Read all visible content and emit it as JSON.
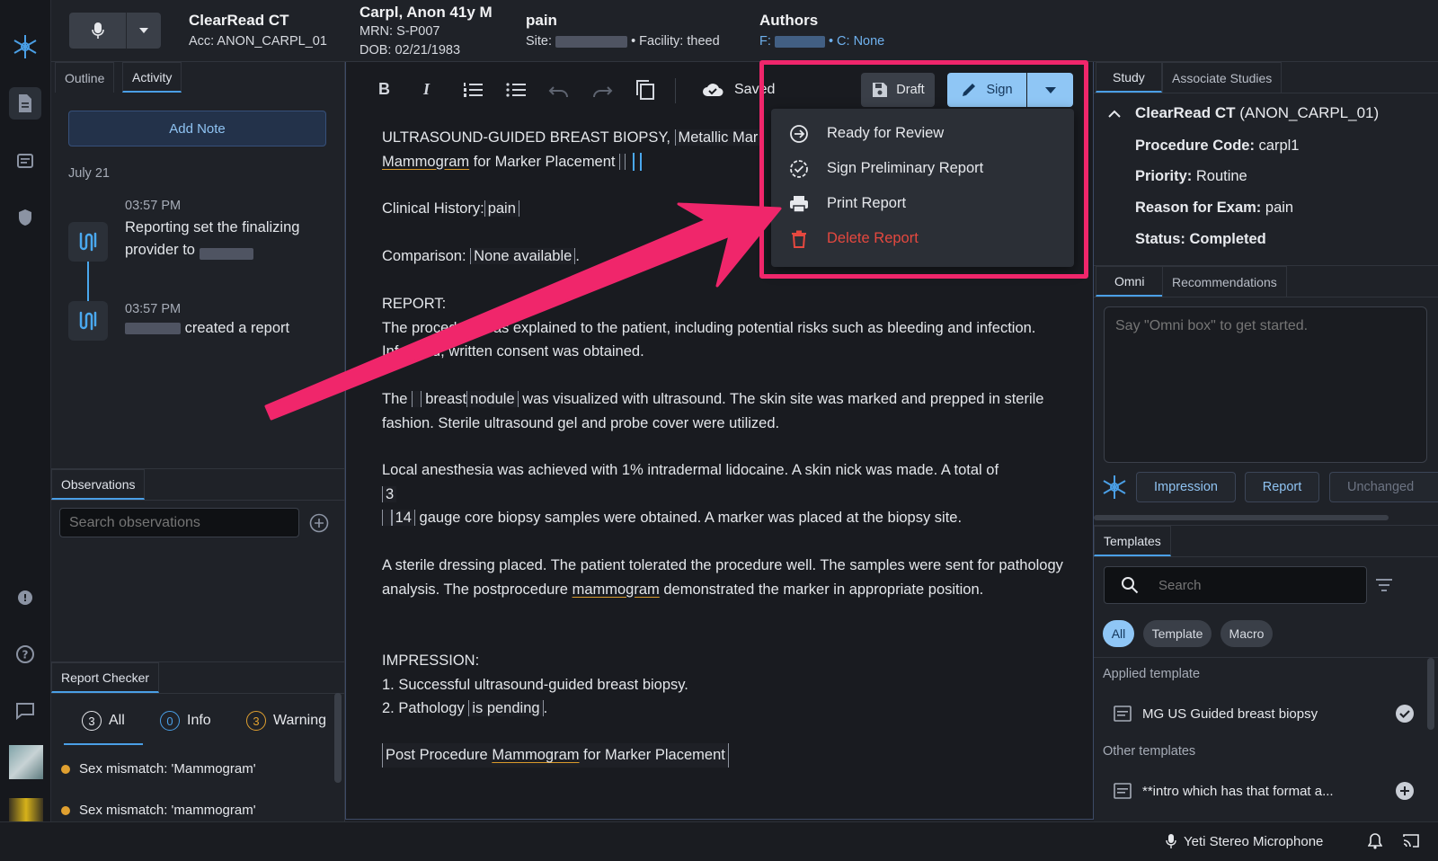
{
  "header": {
    "app_name": "ClearRead CT",
    "accession": "Acc: ANON_CARPL_01",
    "patient_name": "Carpl, Anon 41y M",
    "mrn": "MRN: S-P007",
    "dob": "DOB: 02/21/1983",
    "reason": "pain",
    "site_label": "Site:",
    "facility": "• Facility: theed",
    "authors_label": "Authors",
    "authors_f": "F:",
    "authors_c": "• C: None"
  },
  "left_panel": {
    "tabs": [
      "Outline",
      "Activity"
    ],
    "add_note_label": "Add Note",
    "date_header": "July 21",
    "activity": [
      {
        "time": "03:57 PM",
        "text": "Reporting set the finalizing provider to"
      },
      {
        "time": "03:57 PM",
        "text": "created a report"
      }
    ],
    "observations_tab": "Observations",
    "search_placeholder": "Search observations",
    "report_checker_tab": "Report Checker",
    "checker_filters": [
      {
        "count": "3",
        "label": "All"
      },
      {
        "count": "0",
        "label": "Info"
      },
      {
        "count": "3",
        "label": "Warning"
      }
    ],
    "checker_items": [
      "Sex mismatch: 'Mammogram'",
      "Sex mismatch: 'mammogram'"
    ]
  },
  "toolbar": {
    "saved_label": "Saved",
    "draft_label": "Draft",
    "sign_label": "Sign"
  },
  "sign_menu": {
    "items": [
      {
        "label": "Ready for Review",
        "icon": "arrow-circle-icon"
      },
      {
        "label": "Sign Preliminary Report",
        "icon": "check-circle-icon"
      },
      {
        "label": "Print Report",
        "icon": "printer-icon"
      },
      {
        "label": "Delete Report",
        "icon": "trash-icon",
        "color": "#e5483f"
      }
    ]
  },
  "report": {
    "title_prefix": "ULTRASOUND-GUIDED BREAST BIOPSY,",
    "title_field": "Metallic Mar",
    "title_line2_a": "Mammogram",
    "title_line2_b": "for Marker Placement",
    "clinical_label": "Clinical History:",
    "clinical_value": "pain",
    "comparison_label": "Comparison:",
    "comparison_value": "None available",
    "report_label": "REPORT:",
    "para1": "The procedure was explained to the patient, including potential risks such as bleeding and infection. Informed, written consent was obtained.",
    "para2_a": "The",
    "para2_b": "breast",
    "para2_field": "nodule",
    "para2_c": "was visualized with ultrasound. The skin site was marked and prepped in sterile fashion. Sterile ultrasound gel and probe cover were utilized.",
    "para3_a": "Local anesthesia was achieved with 1% intradermal lidocaine. A skin nick was made. A total of",
    "para3_field1": "3",
    "para3_field2": "14",
    "para3_b": "gauge core biopsy samples were obtained. A marker was placed at the biopsy site.",
    "para4_a": "A sterile dressing placed. The patient tolerated the procedure well. The samples were sent for pathology analysis. The postprocedure",
    "para4_link": "mammogram",
    "para4_b": "demonstrated the marker in appropriate position.",
    "impression_label": "IMPRESSION:",
    "imp1": "1. Successful ultrasound-guided breast biopsy.",
    "imp2_a": "2. Pathology",
    "imp2_field": "is pending",
    "footer_a": "Post Procedure",
    "footer_link": "Mammogram",
    "footer_b": "for Marker Placement"
  },
  "right_panel": {
    "tabs": [
      "Study",
      "Associate Studies"
    ],
    "study_title": "ClearRead CT",
    "study_acc": "(ANON_CARPL_01)",
    "procedure_label": "Procedure Code:",
    "procedure_value": "carpl1",
    "priority_label": "Priority:",
    "priority_value": "Routine",
    "reason_label": "Reason for Exam:",
    "reason_value": "pain",
    "status_label": "Status: Completed",
    "omni_tabs": [
      "Omni",
      "Recommendations"
    ],
    "omni_placeholder": "Say \"Omni box\" to get started.",
    "omni_buttons": [
      "Impression",
      "Report",
      "Unchanged"
    ],
    "templates_tab": "Templates",
    "templates_search_placeholder": "Search",
    "template_filters": [
      "All",
      "Template",
      "Macro"
    ],
    "applied_label": "Applied template",
    "applied_item": "MG US Guided breast biopsy",
    "other_label": "Other templates",
    "other_item": "**intro which has that format a..."
  },
  "status_bar": {
    "microphone": "Yeti Stereo Microphone"
  },
  "colors": {
    "accent": "#4a9fe6",
    "highlight": "#f0266b",
    "danger": "#e5483f",
    "warning": "#e0a030"
  }
}
